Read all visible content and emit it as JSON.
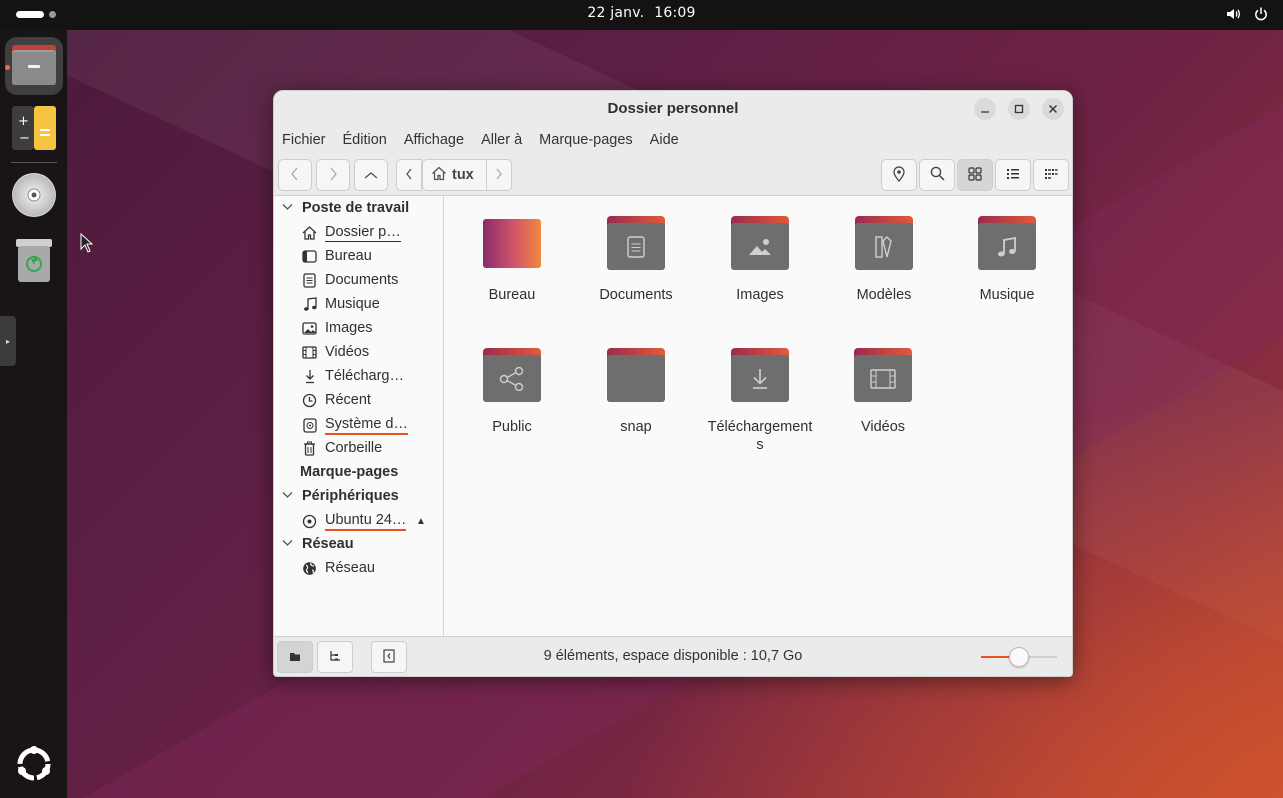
{
  "topbar": {
    "date": "22 janv.",
    "time": "16:09",
    "icons": [
      "speaker-icon",
      "power-icon"
    ]
  },
  "dock": {
    "items": [
      {
        "name": "files",
        "active": true
      },
      {
        "name": "calculator"
      },
      {
        "name": "disc"
      },
      {
        "name": "trash"
      }
    ]
  },
  "window": {
    "title": "Dossier personnel",
    "menu": [
      "Fichier",
      "Édition",
      "Affichage",
      "Aller à",
      "Marque-pages",
      "Aide"
    ],
    "breadcrumb": "tux",
    "sidebar": {
      "sections": [
        {
          "label": "Poste de travail"
        },
        {
          "label": "Marque-pages"
        },
        {
          "label": "Périphériques"
        },
        {
          "label": "Réseau"
        }
      ],
      "places": [
        "Dossier p…",
        "Bureau",
        "Documents",
        "Musique",
        "Images",
        "Vidéos",
        "Télécharg…",
        "Récent",
        "Système d…",
        "Corbeille"
      ],
      "devices": [
        "Ubuntu 24…"
      ],
      "network": [
        "Réseau"
      ]
    },
    "files": [
      {
        "name": "Bureau",
        "icon": "desktop-folder-icon"
      },
      {
        "name": "Documents",
        "icon": "documents-folder-icon"
      },
      {
        "name": "Images",
        "icon": "pictures-folder-icon"
      },
      {
        "name": "Modèles",
        "icon": "templates-folder-icon"
      },
      {
        "name": "Musique",
        "icon": "music-folder-icon"
      },
      {
        "name": "Public",
        "icon": "public-folder-icon"
      },
      {
        "name": "snap",
        "icon": "folder-icon"
      },
      {
        "name": "Téléchargements",
        "icon": "downloads-folder-icon"
      },
      {
        "name": "Vidéos",
        "icon": "videos-folder-icon"
      }
    ],
    "status": "9 éléments, espace disponible : 10,7 Go",
    "zoom_level": 0.5
  },
  "colors": {
    "accent": "#e95420",
    "topbar": "#131313",
    "folder": "#6e6e6e"
  }
}
